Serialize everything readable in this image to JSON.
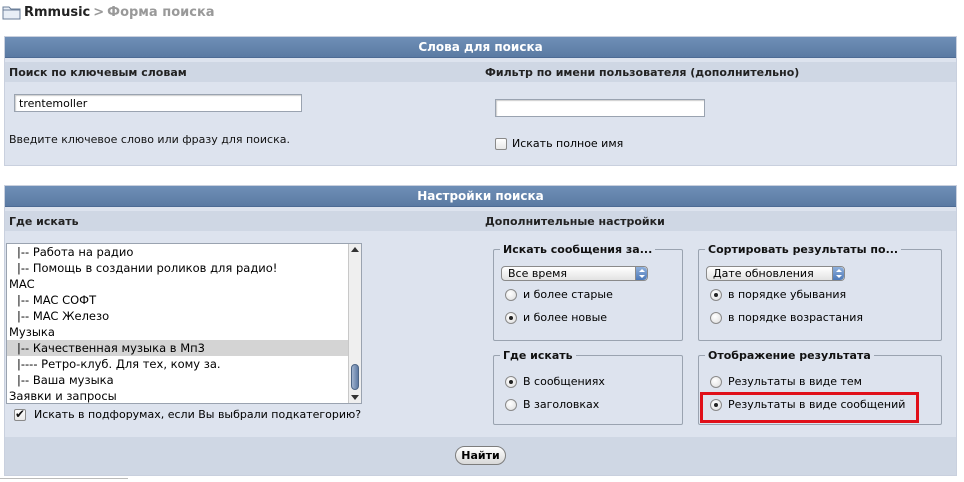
{
  "breadcrumb": {
    "site": "Rmmusic",
    "separator": ">",
    "current": "Форма поиска"
  },
  "keywords_panel": {
    "title": "Слова для поиска",
    "left_header": "Поиск по ключевым словам",
    "right_header": "Фильтр по имени пользователя (дополнительно)",
    "keyword_value": "trentemoller",
    "keyword_hint": "Введите ключевое слово или фразу для поиска.",
    "username_value": "",
    "full_name_label": "Искать полное имя"
  },
  "settings_panel": {
    "title": "Настройки поиска",
    "left_header": "Где искать",
    "right_header": "Дополнительные настройки",
    "forum_list": [
      {
        "label": "|-- Работа на радио",
        "indent": true,
        "selected": false
      },
      {
        "label": "|-- Помощь в создании роликов для радио!",
        "indent": true,
        "selected": false
      },
      {
        "label": "MAC",
        "indent": false,
        "selected": false
      },
      {
        "label": "|-- MAC СОФТ",
        "indent": true,
        "selected": false
      },
      {
        "label": "|-- MAC Железо",
        "indent": true,
        "selected": false
      },
      {
        "label": "Музыка",
        "indent": false,
        "selected": false
      },
      {
        "label": "|-- Качественная музыка в Мп3",
        "indent": true,
        "selected": true
      },
      {
        "label": "|---- Ретро-клуб. Для тех, кому за.",
        "indent": true,
        "selected": false
      },
      {
        "label": "|-- Ваша музыка",
        "indent": true,
        "selected": false
      },
      {
        "label": "Заявки и запросы",
        "indent": false,
        "selected": false
      }
    ],
    "subforums_label": "Искать в подфорумах, если Вы выбрали подкатегорию?",
    "time_group": {
      "legend": "Искать сообщения за...",
      "select_value": "Все время",
      "options": [
        "и более старые",
        "и более новые"
      ],
      "checked": 1
    },
    "sort_group": {
      "legend": "Сортировать результаты по...",
      "select_value": "Дате обновления",
      "options": [
        "в порядке убывания",
        "в порядке возрастания"
      ],
      "checked": 0
    },
    "where_group": {
      "legend": "Где искать",
      "options": [
        "В сообщениях",
        "В заголовках"
      ],
      "checked": 0
    },
    "display_group": {
      "legend": "Отображение результата",
      "options": [
        "Результаты в виде тем",
        "Результаты в виде сообщений"
      ],
      "checked": 1
    }
  },
  "submit_label": "Найти",
  "colors": {
    "header_bg": "#5a7aa3",
    "panel_bg": "#dde3ee",
    "highlight": "#e0101a"
  }
}
